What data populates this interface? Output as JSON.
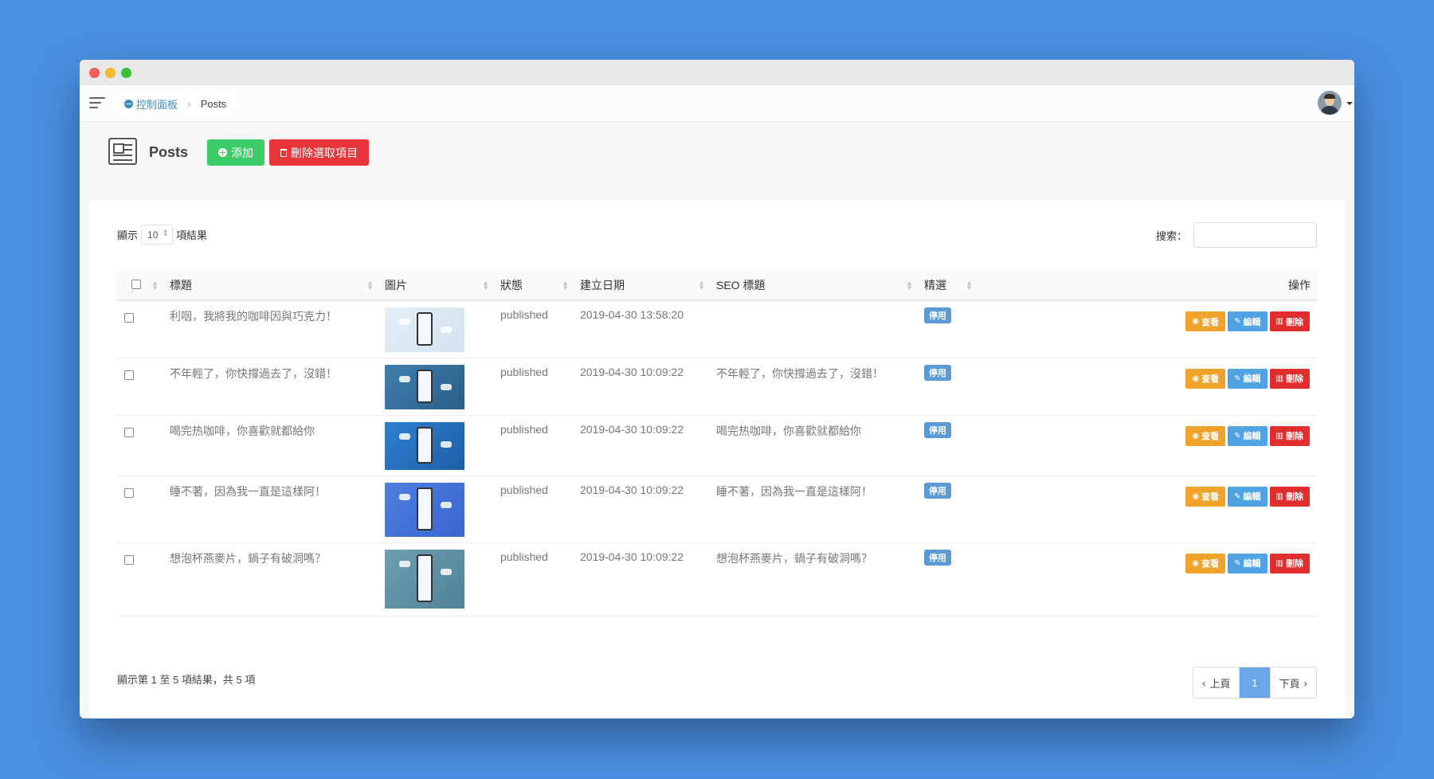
{
  "breadcrumb": {
    "home": "控制面板",
    "current": "Posts"
  },
  "header": {
    "title": "Posts",
    "add_label": "添加",
    "delete_selected_label": "刪除選取項目"
  },
  "controls": {
    "show_label": "顯示",
    "page_length": "10",
    "results_label": "項結果",
    "search_label": "搜索：",
    "search_value": ""
  },
  "columns": [
    "標題",
    "圖片",
    "狀態",
    "建立日期",
    "SEO 標題",
    "精選",
    "操作"
  ],
  "rows": [
    {
      "title": "利咽，我將我的咖啡因與巧克力！",
      "status": "published",
      "date": "2019-04-30 13:58:20",
      "seo": "",
      "featured": "停用",
      "image": "illustration-people-phone"
    },
    {
      "title": "不年輕了，你快撐過去了，沒錯！",
      "status": "published",
      "date": "2019-04-30 10:09:22",
      "seo": "不年輕了，你快撐過去了，沒錯！",
      "featured": "停用",
      "image": "phone-chat-dark-blue"
    },
    {
      "title": "喝完热咖啡，你喜歡就都給你",
      "status": "published",
      "date": "2019-04-30 10:09:22",
      "seo": "喝完热咖啡，你喜歡就都給你",
      "featured": "停用",
      "image": "hand-phone-blue"
    },
    {
      "title": "睡不著，因為我一直是這樣阿！",
      "status": "published",
      "date": "2019-04-30 10:09:22",
      "seo": "睡不著，因為我一直是這樣阿！",
      "featured": "停用",
      "image": "robot-chat-bubbles"
    },
    {
      "title": "想泡杯燕麥片，鍋子有破洞嗎？",
      "status": "published",
      "date": "2019-04-30 10:09:22",
      "seo": "想泡杯燕麥片，鍋子有破洞嗎？",
      "featured": "停用",
      "image": "hand-phone-teal"
    }
  ],
  "actions": {
    "view": "查看",
    "edit": "編輯",
    "delete": "刪除"
  },
  "footer": {
    "info": "顯示第 1 至 5 項結果，共 5 項",
    "prev": "上頁",
    "page": "1",
    "next": "下頁"
  },
  "colors": {
    "background": "#4a90e2",
    "add": "#3ccc6a",
    "danger": "#e8353a",
    "view": "#f0a32a",
    "edit": "#4fa3e2",
    "badge": "#5b9bd5",
    "page_active": "#6aa6e8"
  }
}
